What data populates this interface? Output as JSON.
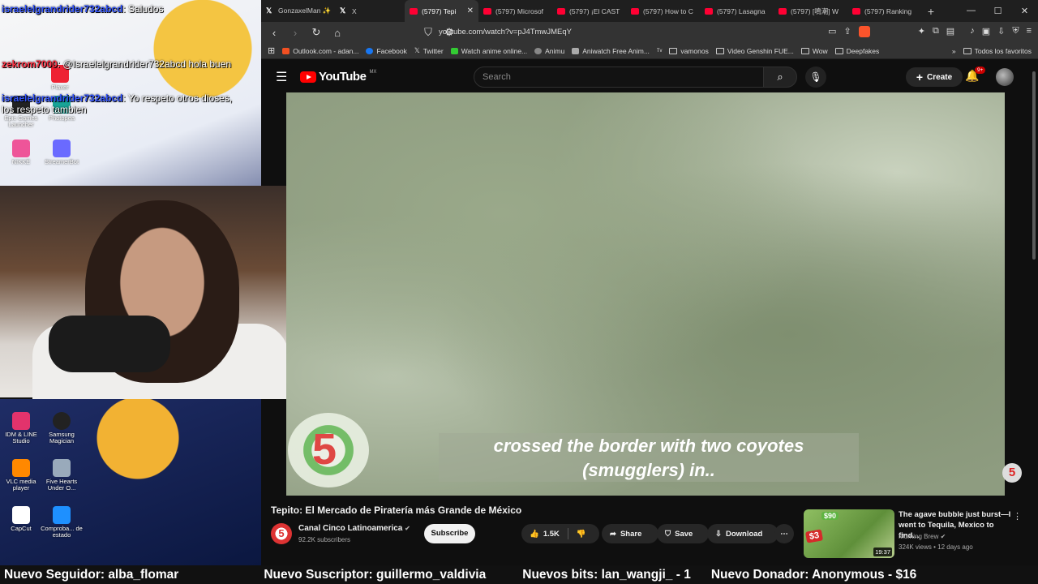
{
  "overlay": {
    "chat": [
      {
        "user": "israelelgrandrider732abcd",
        "msg": ": Saludos"
      },
      {
        "user": "zekrom7000",
        "msg": ": @Israelelgrandrider732abcd hola buen"
      },
      {
        "user": "israelelgrandrider732abcd",
        "msg": ": Yo respeto otros dioses, los respeto tambien"
      }
    ],
    "desktop_icons": [
      "Plaxer",
      "Honkai Star Rail",
      "Epic Games Launcher",
      "Photopea",
      "NIKKE",
      "StreamerBot",
      "IDM & LINE Studio",
      "Samsung Magician",
      "VLC media player",
      "Five Hearts Under O...",
      "CapCut",
      "Comproba... de estado"
    ]
  },
  "browser": {
    "tabs": [
      {
        "label": "GonzaxelMan ✨",
        "icon": "x-logo"
      },
      {
        "label": "X",
        "icon": "x-logo"
      },
      {
        "label": "(5797) Tepi",
        "icon": "youtube-icon",
        "active": true
      },
      {
        "label": "(5797) Microsof",
        "icon": "youtube-icon"
      },
      {
        "label": "(5797) ¡El CAST",
        "icon": "youtube-icon"
      },
      {
        "label": "(5797) How to C",
        "icon": "youtube-icon"
      },
      {
        "label": "(5797) Lasagna",
        "icon": "youtube-icon"
      },
      {
        "label": "(5797) [鳴潮] W",
        "icon": "youtube-icon"
      },
      {
        "label": "(5797) Ranking",
        "icon": "youtube-icon"
      }
    ],
    "url": "youtube.com/watch?v=pJ4TmwJMEqY",
    "bookmarks": [
      "Outlook.com - adan...",
      "Facebook",
      "Twitter",
      "Watch anime online...",
      "Animu",
      "Aniwatch Free Anim...",
      "vamonos",
      "Video Genshin FUE...",
      "Wow",
      "Deepfakes"
    ],
    "bookmarks_right": "Todos los favoritos"
  },
  "youtube": {
    "logo": "YouTube",
    "country": "MX",
    "search_placeholder": "Search",
    "create_label": "Create",
    "notif_badge": "9+",
    "subtitle_line1": "crossed the border with two coyotes",
    "subtitle_line2": "(smugglers) in..",
    "channel_logo_text": "5",
    "video_title": "Tepito: El Mercado de Piratería más Grande de México",
    "channel_name": "Canal Cinco Latinoamerica",
    "channel_subs": "92.2K subscribers",
    "subscribe_label": "Subscribe",
    "likes": "1.5K",
    "share_label": "Share",
    "save_label": "Save",
    "download_label": "Download",
    "recommended": {
      "title": "The agave bubble just burst—I went to Tequila, Mexico to find...",
      "channel": "Morning Brew",
      "meta": "324K views • 12 days ago",
      "duration": "19:37",
      "tag1": "$90",
      "tag2": "$3"
    }
  },
  "ticker": [
    "Nuevo Seguidor: alba_flomar",
    "Nuevo Suscriptor: guillermo_valdivia",
    "Nuevos bits: lan_wangji_ - 1",
    "Nuevo Donador: Anonymous - $16"
  ],
  "colors": {
    "youtube_red": "#ff0000",
    "chat_user": "#3355ff",
    "chat_user_alt": "#ff3344"
  }
}
